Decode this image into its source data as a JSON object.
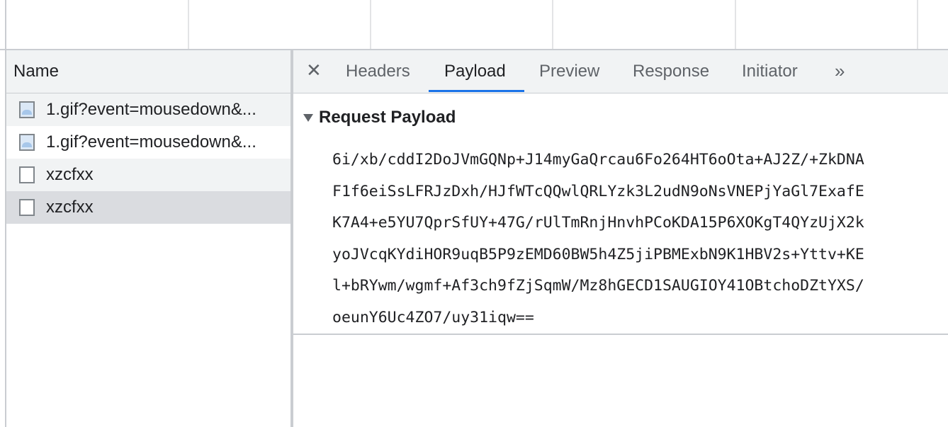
{
  "name_column": {
    "header": "Name",
    "requests": [
      {
        "label": "1.gif?event=mousedown&...",
        "icon": "image-file-icon"
      },
      {
        "label": "1.gif?event=mousedown&...",
        "icon": "image-file-icon"
      },
      {
        "label": "xzcfxx",
        "icon": "document-icon"
      },
      {
        "label": "xzcfxx",
        "icon": "document-icon",
        "selected": true
      }
    ]
  },
  "details": {
    "close_label": "✕",
    "tabs": [
      {
        "label": "Headers"
      },
      {
        "label": "Payload",
        "active": true
      },
      {
        "label": "Preview"
      },
      {
        "label": "Response"
      },
      {
        "label": "Initiator"
      }
    ],
    "more_tabs_label": "»",
    "payload": {
      "section_title": "Request Payload",
      "lines": [
        "6i/xb/cddI2DoJVmGQNp+J14myGaQrcau6Fo264HT6oOta+AJ2Z/+ZkDNA",
        "F1f6eiSsLFRJzDxh/HJfWTcQQwlQRLYzk3L2udN9oNsVNEPjYaGl7ExafE",
        "K7A4+e5YU7QprSfUY+47G/rUlTmRnjHnvhPCoKDA15P6XOKgT4QYzUjX2k",
        "yoJVcqKYdiHOR9uqB5P9zEMD60BW5h4Z5jiPBMExbN9K1HBV2s+Yttv+KE",
        "l+bRYwm/wgmf+Af3ch9fZjSqmW/Mz8hGECD1SAUGIOY41OBtchoDZtYXS/",
        "oeunY6Uc4ZO7/uy31iqw=="
      ]
    }
  },
  "colors": {
    "active_tab_underline": "#1a73e8",
    "selected_row": "#dadce0",
    "header_background": "#f1f3f4"
  }
}
